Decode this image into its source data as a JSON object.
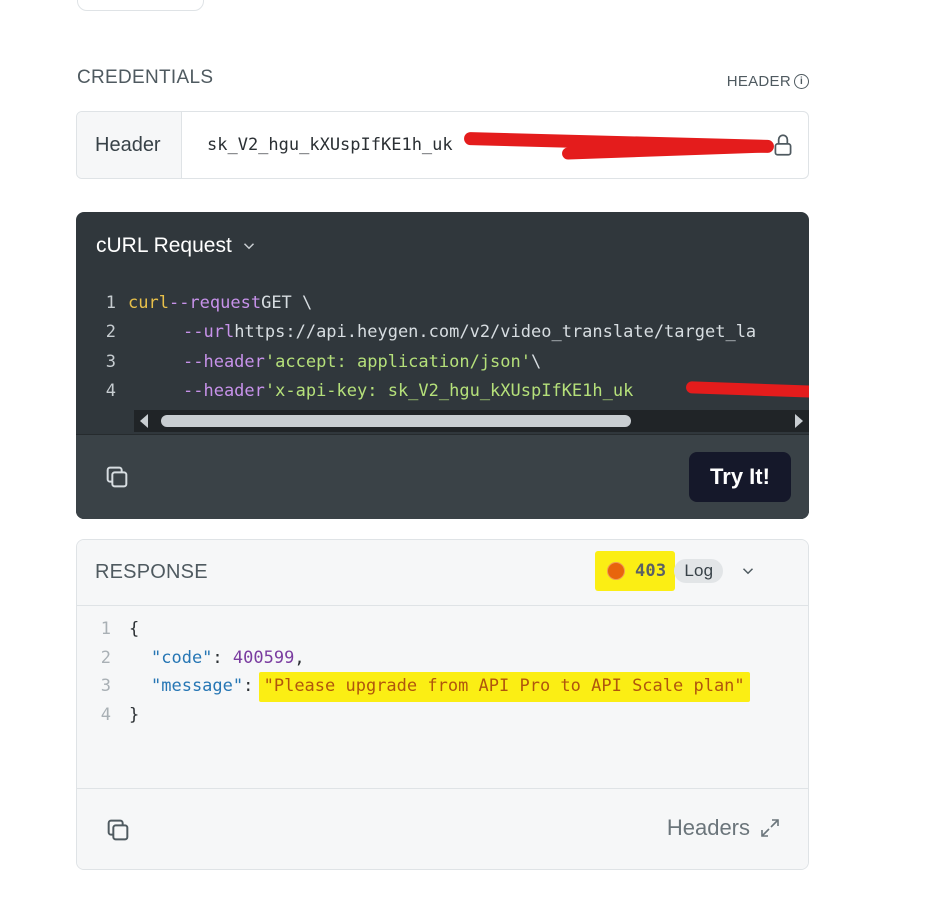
{
  "credentials": {
    "title": "CREDENTIALS",
    "location_tag": "HEADER",
    "row_label": "Header",
    "api_key_visible": "sk_V2_hgu_kXUspIfKE1h_uk"
  },
  "curl": {
    "title": "cURL Request",
    "lines": [
      {
        "n": "1",
        "a": "curl",
        "b": " --request",
        "c": " GET \\",
        "d": ""
      },
      {
        "n": "2",
        "a": "",
        "b": "--url",
        "c": " https://api.heygen.com/v2/video_translate/target_la",
        "d": ""
      },
      {
        "n": "3",
        "a": "",
        "b": "--header",
        "c": " ",
        "d": "'accept: application/json'",
        "e": " \\"
      },
      {
        "n": "4",
        "a": "",
        "b": "--header",
        "c": " ",
        "d": "'x-api-key: sk_V2_hgu_kXUspIfKE1h_uk"
      }
    ],
    "try_label": "Try It!"
  },
  "response": {
    "title": "RESPONSE",
    "status_code": "403",
    "log_label": "Log",
    "lines": [
      {
        "n": "1"
      },
      {
        "n": "2"
      },
      {
        "n": "3"
      },
      {
        "n": "4"
      }
    ],
    "open_brace": "{",
    "close_brace": "}",
    "code_key": "\"code\"",
    "code_value": "400599",
    "message_key": "\"message\"",
    "message_value": "\"Please upgrade from API Pro to API Scale plan\"",
    "headers_label": "Headers"
  },
  "icons": [
    "info-icon",
    "lock-icon",
    "chevron-down-icon",
    "copy-icon",
    "expand-icon",
    "status-dot"
  ],
  "colors": {
    "status_error": "#e8650c",
    "highlight": "#fbee14",
    "redaction": "#e41c1c",
    "code_bg": "#30373c"
  }
}
